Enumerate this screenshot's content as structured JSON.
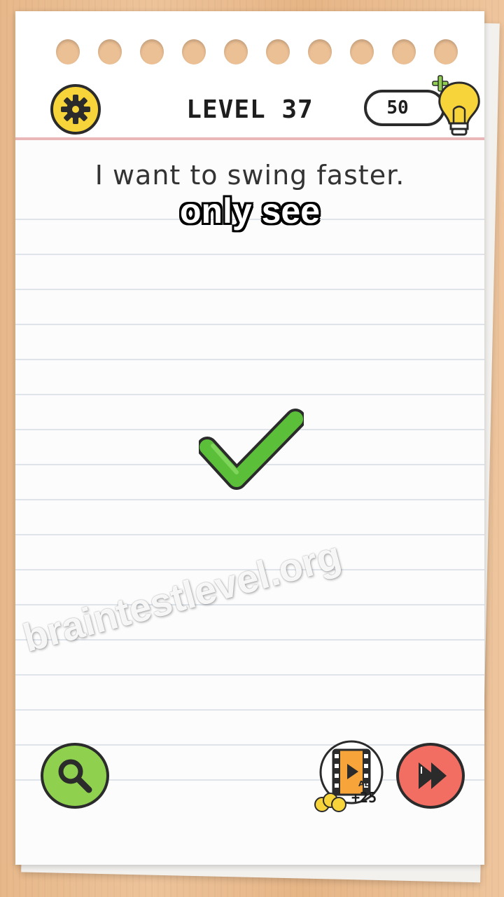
{
  "header": {
    "level_label": "LEVEL 37",
    "hint_count": "50"
  },
  "question": {
    "text": "I want to swing faster."
  },
  "caption": {
    "text": "only see"
  },
  "result": {
    "icon": "checkmark-icon",
    "color": "#5bbf3a"
  },
  "watermark": {
    "text": "braintestlevel.org"
  },
  "footer": {
    "ad_reward": "+25",
    "ad_badge": "AD"
  },
  "colors": {
    "settings": "#f7d53a",
    "search": "#8fd14f",
    "next": "#f26d62",
    "bulb": "#f7d53a"
  }
}
